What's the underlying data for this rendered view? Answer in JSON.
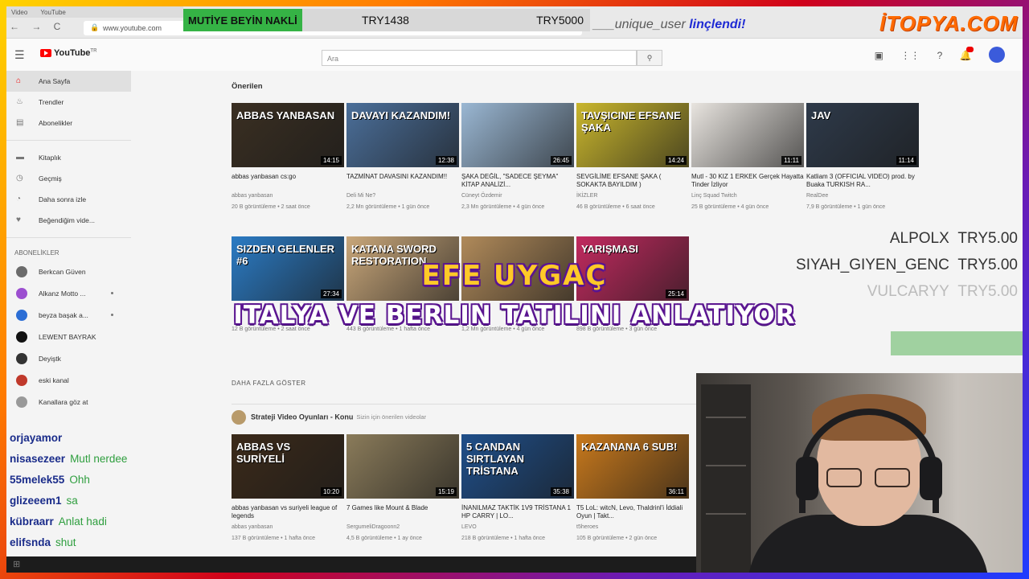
{
  "browser": {
    "tabs": [
      "Video",
      "YouTube"
    ],
    "url": "www.youtube.com",
    "nav": "←  →  C"
  },
  "stream": {
    "green_banner": "MUTİYE BEYİN NAKLİ",
    "donation_left": "TRY1438",
    "donation_right": "TRY5000",
    "ban_user": "___unique_user",
    "ban_text": "linçlendi!",
    "sponsor_logo": "İTOPYA.COM",
    "title_line1": "EFE UYGAÇ",
    "title_line2": "ITALYA VE BERLIN TATILINI ANLATIYOR",
    "donations": [
      {
        "name": "ALPOLX",
        "amount": "TRY5.00"
      },
      {
        "name": "SIYAH_GIYEN_GENC",
        "amount": "TRY5.00"
      },
      {
        "name": "VULCARYY",
        "amount": "TRY5.00"
      },
      {
        "name": "",
        "amount": ""
      }
    ],
    "chat": [
      {
        "user": "orjayamor",
        "msg": ""
      },
      {
        "user": "nisasezeer",
        "msg": "Mutl nerdee"
      },
      {
        "user": "55melek55",
        "msg": "Ohh"
      },
      {
        "user": "glizeeem1",
        "msg": "sa"
      },
      {
        "user": "kübraarr",
        "msg": "Anlat hadi"
      },
      {
        "user": "elifsnda",
        "msg": "shut"
      }
    ]
  },
  "youtube": {
    "logo": "YouTube",
    "logo_suffix": "TR",
    "search_placeholder": "Ara",
    "icons": [
      "video-icon",
      "apps-icon",
      "help-icon",
      "bell-icon"
    ],
    "sidebar": {
      "main": [
        {
          "label": "Ana Sayfa",
          "icon": "home-icon",
          "glyph": "⌂"
        },
        {
          "label": "Trendler",
          "icon": "fire-icon",
          "glyph": "♨"
        },
        {
          "label": "Abonelikler",
          "icon": "subscriptions-icon",
          "glyph": "▤"
        }
      ],
      "library": [
        {
          "label": "Kitaplık",
          "icon": "folder-icon",
          "glyph": "▬"
        },
        {
          "label": "Geçmiş",
          "icon": "history-icon",
          "glyph": "◷"
        },
        {
          "label": "Daha sonra izle",
          "icon": "clock-icon",
          "glyph": "◔"
        },
        {
          "label": "Beğendiğim vide...",
          "icon": "like-icon",
          "glyph": "♥"
        }
      ],
      "subs_heading": "ABONELİKLER",
      "subs": [
        {
          "label": "Berkcan Güven",
          "color": "#6b6b6b",
          "dot": false
        },
        {
          "label": "Alkanz Motto ...",
          "color": "#9c4fd0",
          "dot": true
        },
        {
          "label": "beyza başak a...",
          "color": "#2c6ed5",
          "dot": true
        },
        {
          "label": "LEWENT BAYRAK",
          "color": "#111111",
          "dot": false
        },
        {
          "label": "Deyiştk",
          "color": "#333333",
          "dot": false
        },
        {
          "label": "eski kanal",
          "color": "#c0392b",
          "dot": false
        },
        {
          "label": "Kanallara göz at",
          "color": "#999999",
          "dot": false
        }
      ]
    },
    "recommended_title": "Önerilen",
    "row1": [
      {
        "title": "abbas yanbasan cs:go",
        "channel": "abbas yanbasan",
        "meta": "20 B görüntüleme • 2 saat önce",
        "duration": "14:15",
        "bg": "#3a2f22",
        "text": "ABBAS YANBASAN"
      },
      {
        "title": "TAZMİNAT DAVASINI KAZANDIM!!",
        "channel": "Deli Mi Ne?",
        "meta": "2,2 Mn görüntüleme • 1 gün önce",
        "duration": "12:38",
        "bg": "#4b6f9a",
        "text": "DAVAYI KAZANDIM!"
      },
      {
        "title": "ŞAKA DEĞİL, \"SADECE ŞEYMA\" KİTAP ANALİZİ...",
        "channel": "Cüneyt Özdemir",
        "meta": "2,3 Mn görüntüleme • 4 gün önce",
        "duration": "26:45",
        "bg": "#9ab7d3",
        "text": ""
      },
      {
        "title": "SEVGİLİME EFSANE ŞAKA ( SOKAKTA BAYILDIM )",
        "channel": "İKİZLER",
        "meta": "46 B görüntüleme • 6 saat önce",
        "duration": "14:24",
        "bg": "#c9b62d",
        "text": "TAVŞICINE EFSANE ŞAKA"
      },
      {
        "title": "Mutl - 30 KIZ 1 ERKEK Gerçek Hayatta Tinder İzliyor",
        "channel": "Linç Squad Twitch",
        "meta": "25 B görüntüleme • 4 gün önce",
        "duration": "11:11",
        "bg": "#e8e4df",
        "text": ""
      },
      {
        "title": "Katliam 3 (OFFICIAL VIDEO) prod. by Buaka TURKISH RA...",
        "channel": "RealDee",
        "meta": "7,9 B görüntüleme • 1 gün önce",
        "duration": "11:14",
        "bg": "#2e3a4a",
        "text": "JAV"
      }
    ],
    "row2": [
      {
        "title": "",
        "channel": "",
        "meta": "12 B görüntüleme • 2 saat önce",
        "duration": "27:34",
        "bg": "#2b7bc4",
        "text": "SIZDEN GELENLER #6"
      },
      {
        "title": "",
        "channel": "",
        "meta": "443 B görüntüleme • 1 hafta önce",
        "duration": "",
        "bg": "#c9a77a",
        "text": "KATANA SWORD RESTORATION"
      },
      {
        "title": "",
        "channel": "",
        "meta": "1,2 Mn görüntüleme • 4 gün önce",
        "duration": "",
        "bg": "#b08a5a",
        "text": ""
      },
      {
        "title": "",
        "channel": "",
        "meta": "898 B görüntüleme • 3 gün önce",
        "duration": "25:14",
        "bg": "#c22a5f",
        "text": "YARIŞMASI"
      }
    ],
    "more_label": "DAHA FAZLA GÖSTER",
    "strategy": {
      "title": "Strateji Video Oyunları - Konu",
      "subtitle": "Sizin için önerilen videolar"
    },
    "row3": [
      {
        "title": "abbas yanbasan vs suriyeli league of legends",
        "channel": "abbas yanbasan",
        "meta": "137 B görüntüleme • 1 hafta önce",
        "duration": "10:20",
        "bg": "#3b2a1a",
        "text": "ABBAS VS SURİYELİ"
      },
      {
        "title": "7 Games like Mount & Blade",
        "channel": "SergumeliDragoonn2",
        "meta": "4,5 B görüntüleme • 1 ay önce",
        "duration": "15:19",
        "bg": "#8a7b5a",
        "text": ""
      },
      {
        "title": "İNANILMAZ TAKTİK 1V9 TRİSTANA 1 HP CARRY | LO...",
        "channel": "LEVO",
        "meta": "218 B görüntüleme • 1 hafta önce",
        "duration": "35:38",
        "bg": "#1f4f8a",
        "text": "5 CANDAN SIRTLAYAN TRİSTANA"
      },
      {
        "title": "T5 LoL: witcN, Levo, Thaldrinl'i İddiali Oyun | Takt...",
        "channel": "t5heroes",
        "meta": "105 B görüntüleme • 2 gün önce",
        "duration": "36:11",
        "bg": "#c8791c",
        "text": "KAZANANA 6 SUB!"
      }
    ]
  }
}
